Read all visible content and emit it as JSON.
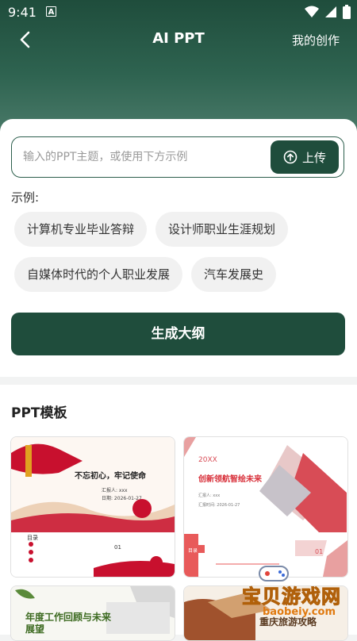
{
  "status": {
    "time": "9:41",
    "notif": "A"
  },
  "nav": {
    "title": "AI PPT",
    "my_work": "我的创作"
  },
  "input": {
    "placeholder": "输入的PPT主题，或使用下方示例",
    "value": ""
  },
  "upload": {
    "label": "上传"
  },
  "examples": {
    "label": "示例:",
    "items": [
      "计算机专业毕业答辩",
      "设计师职业生涯规划",
      "自媒体时代的个人职业发展",
      "汽车发展史"
    ]
  },
  "generate": {
    "label": "生成大纲"
  },
  "templates": {
    "title": "PPT模板",
    "items": [
      {
        "heading": "不忘初心，牢记使命",
        "line1": "汇报人: xxx",
        "line2": "日期: 2026-01-27",
        "sub": "目录",
        "sub2": "01"
      },
      {
        "tag": "20XX",
        "heading": "创新领航智绘未来",
        "line1": "汇报人: xxx",
        "line2": "汇报时间: 2026-01-27",
        "num": "01",
        "sub": "目录"
      },
      {
        "heading": "年度工作回顾与未来展望"
      },
      {
        "heading": "重庆旅游攻略"
      }
    ]
  },
  "watermark": {
    "main": "宝贝游戏网",
    "sub": "baobeiy.com"
  },
  "colors": {
    "primary": "#1f4d3c",
    "accent_red": "#c8102e",
    "chip_bg": "#f1f1f1"
  }
}
